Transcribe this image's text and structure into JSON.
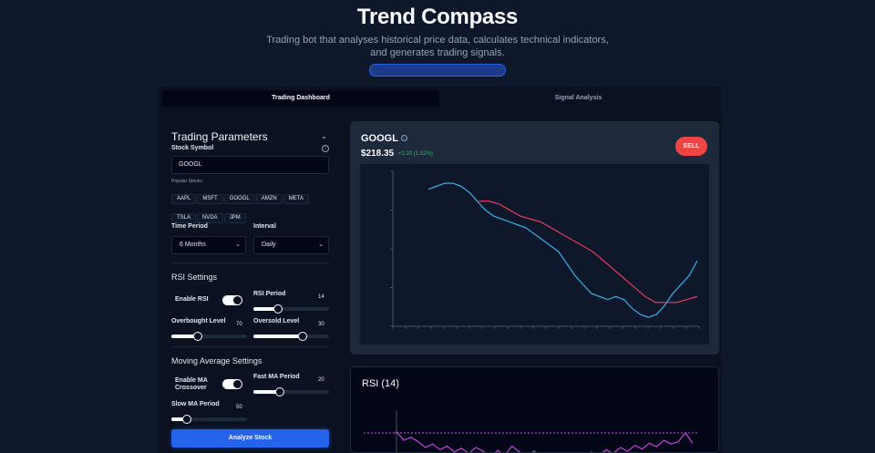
{
  "header": {
    "title": "Trend Compass",
    "subtitle": "Trading bot that analyses historical price data, calculates technical indicators, and generates trading signals."
  },
  "tabs": [
    "Trading Dashboard",
    "Signal Analysis"
  ],
  "params": {
    "title": "Trading Parameters",
    "stock_symbol_label": "Stock Symbol",
    "symbol_value": "GOOGL",
    "popular_label": "Popular Stocks:",
    "popular": [
      "AAPL",
      "MSFT",
      "GOOGL",
      "AMZN",
      "META",
      "TSLA",
      "NVDA",
      "JPM"
    ],
    "time_period_label": "Time Period",
    "time_period_value": "6 Months",
    "interval_label": "Interval",
    "interval_value": "Daily",
    "rsi_title": "RSI Settings",
    "enable_rsi_label": "Enable RSI",
    "enable_rsi": true,
    "rsi_period_label": "RSI Period",
    "rsi_period": "14",
    "overbought_label": "Overbought Level",
    "overbought": "70",
    "oversold_label": "Oversold Level",
    "oversold": "30",
    "ma_title": "Moving Average Settings",
    "ma_cross_label": "Enable MA Crossover",
    "ma_cross": true,
    "fast_ma_label": "Fast MA Period",
    "fast_ma": "20",
    "slow_ma_label": "Slow MA Period",
    "slow_ma": "50",
    "analyze_label": "Analyze Stock"
  },
  "stock": {
    "symbol": "GOOGL",
    "price": "$218.35",
    "change": "+2.20 (1.02%)",
    "signal": "SELL"
  },
  "rsi_card": {
    "title": "RSI (14)"
  },
  "colors": {
    "fast_ma": "#38bdf8",
    "slow_ma": "#f43f5e",
    "rsi_line": "#d946ef",
    "sell": "#ef4444",
    "accent": "#2563eb"
  },
  "sliders": {
    "rsi_period": 0.33,
    "overbought": 0.35,
    "oversold": 0.65,
    "fast_ma": 0.35,
    "slow_ma": 0.2
  },
  "chart_data": [
    {
      "type": "line",
      "series": [
        {
          "values": [
            238,
            239,
            240,
            240,
            239,
            237,
            234,
            231,
            229,
            228,
            227,
            226,
            225,
            223,
            221,
            219,
            217,
            213,
            209,
            206,
            203,
            202,
            201,
            202,
            201,
            198,
            196,
            195,
            196,
            199,
            203,
            206,
            209,
            214
          ]
        },
        {
          "values": [
            234,
            234,
            233,
            231,
            229,
            228,
            227,
            225,
            223,
            221,
            219,
            217,
            214,
            211,
            208,
            205,
            202,
            200,
            200,
            200,
            201,
            202
          ]
        }
      ]
    },
    {
      "type": "line",
      "series": [
        {
          "values": [
            72,
            60,
            64,
            58,
            50,
            55,
            47,
            52,
            44,
            49,
            42,
            50,
            45,
            38,
            46,
            40,
            52,
            44,
            36,
            45,
            40,
            33,
            42,
            38,
            30,
            41,
            36,
            44,
            39,
            47,
            42,
            50,
            45,
            53,
            48,
            56,
            51,
            60,
            55,
            58,
            70,
            56
          ]
        }
      ]
    }
  ]
}
